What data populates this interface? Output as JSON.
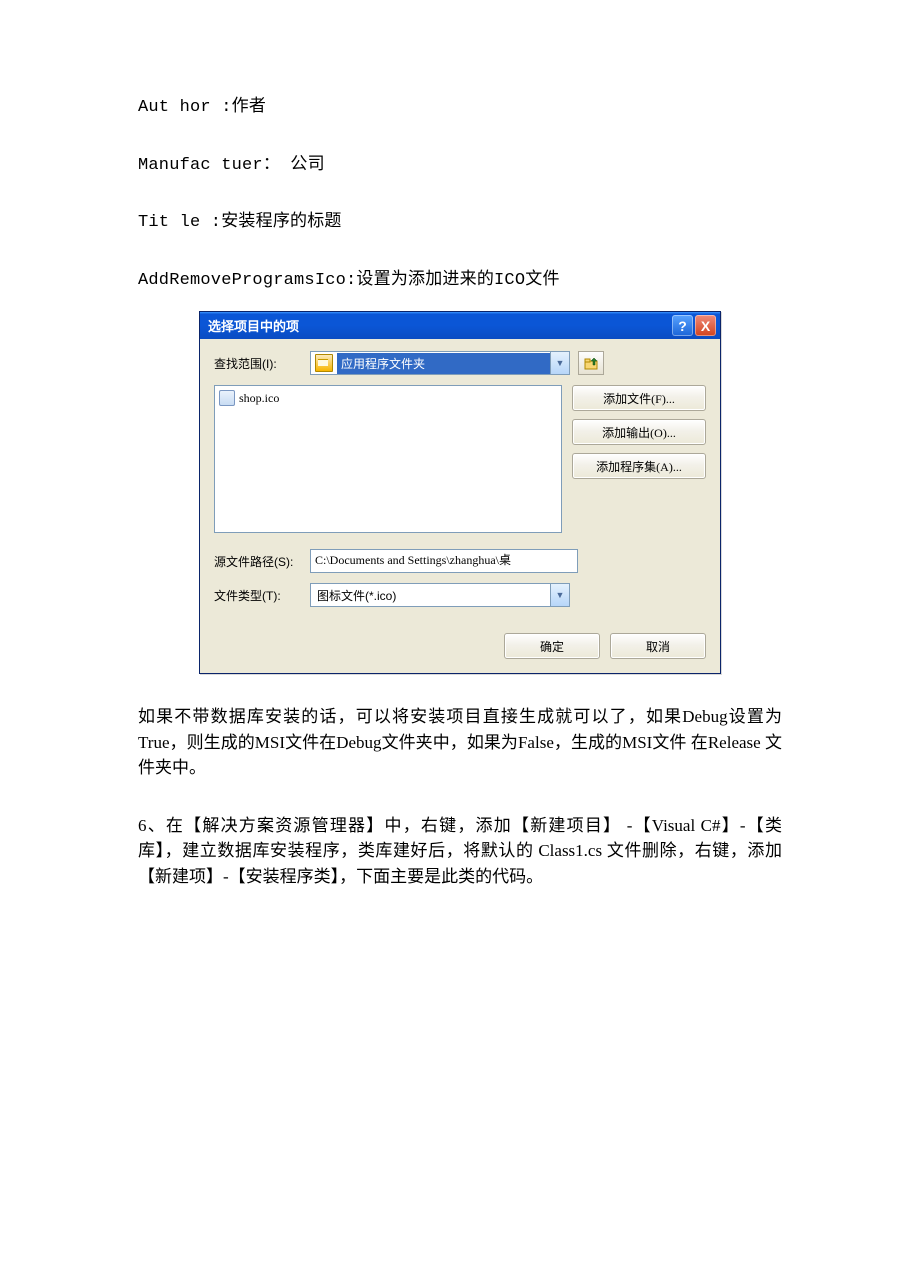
{
  "doc": {
    "p1": "Aut hor :作者",
    "p2": "Manufac tuer：  公司",
    "p3": "Tit le :安装程序的标题",
    "p4": "AddRemoveProgramsIco:设置为添加进来的ICO文件",
    "p5": "如果不带数据库安装的话，可以将安装项目直接生成就可以了，如果Debug设置为True，则生成的MSI文件在Debug文件夹中，如果为False，生成的MSI文件  在Release 文件夹中。",
    "p6": "6、在【解决方案资源管理器】中，右键，添加【新建项目】 -【Visual C#】-【类库】，建立数据库安装程序，类库建好后，将默认的 Class1.cs 文件删除，右键，添加【新建项】-【安装程序类】，下面主要是此类的代码。"
  },
  "dialog": {
    "title": "选择项目中的项",
    "help": "?",
    "close": "X",
    "lookin_label": "查找范围(I):",
    "lookin_value": "应用程序文件夹",
    "file_item": "shop.ico",
    "btn_add_file": "添加文件(F)...",
    "btn_add_output": "添加输出(O)...",
    "btn_add_assembly": "添加程序集(A)...",
    "src_label": "源文件路径(S):",
    "src_value": "C:\\Documents and Settings\\zhanghua\\桌",
    "type_label": "文件类型(T):",
    "type_value": "图标文件(*.ico)",
    "ok": "确定",
    "cancel": "取消"
  }
}
